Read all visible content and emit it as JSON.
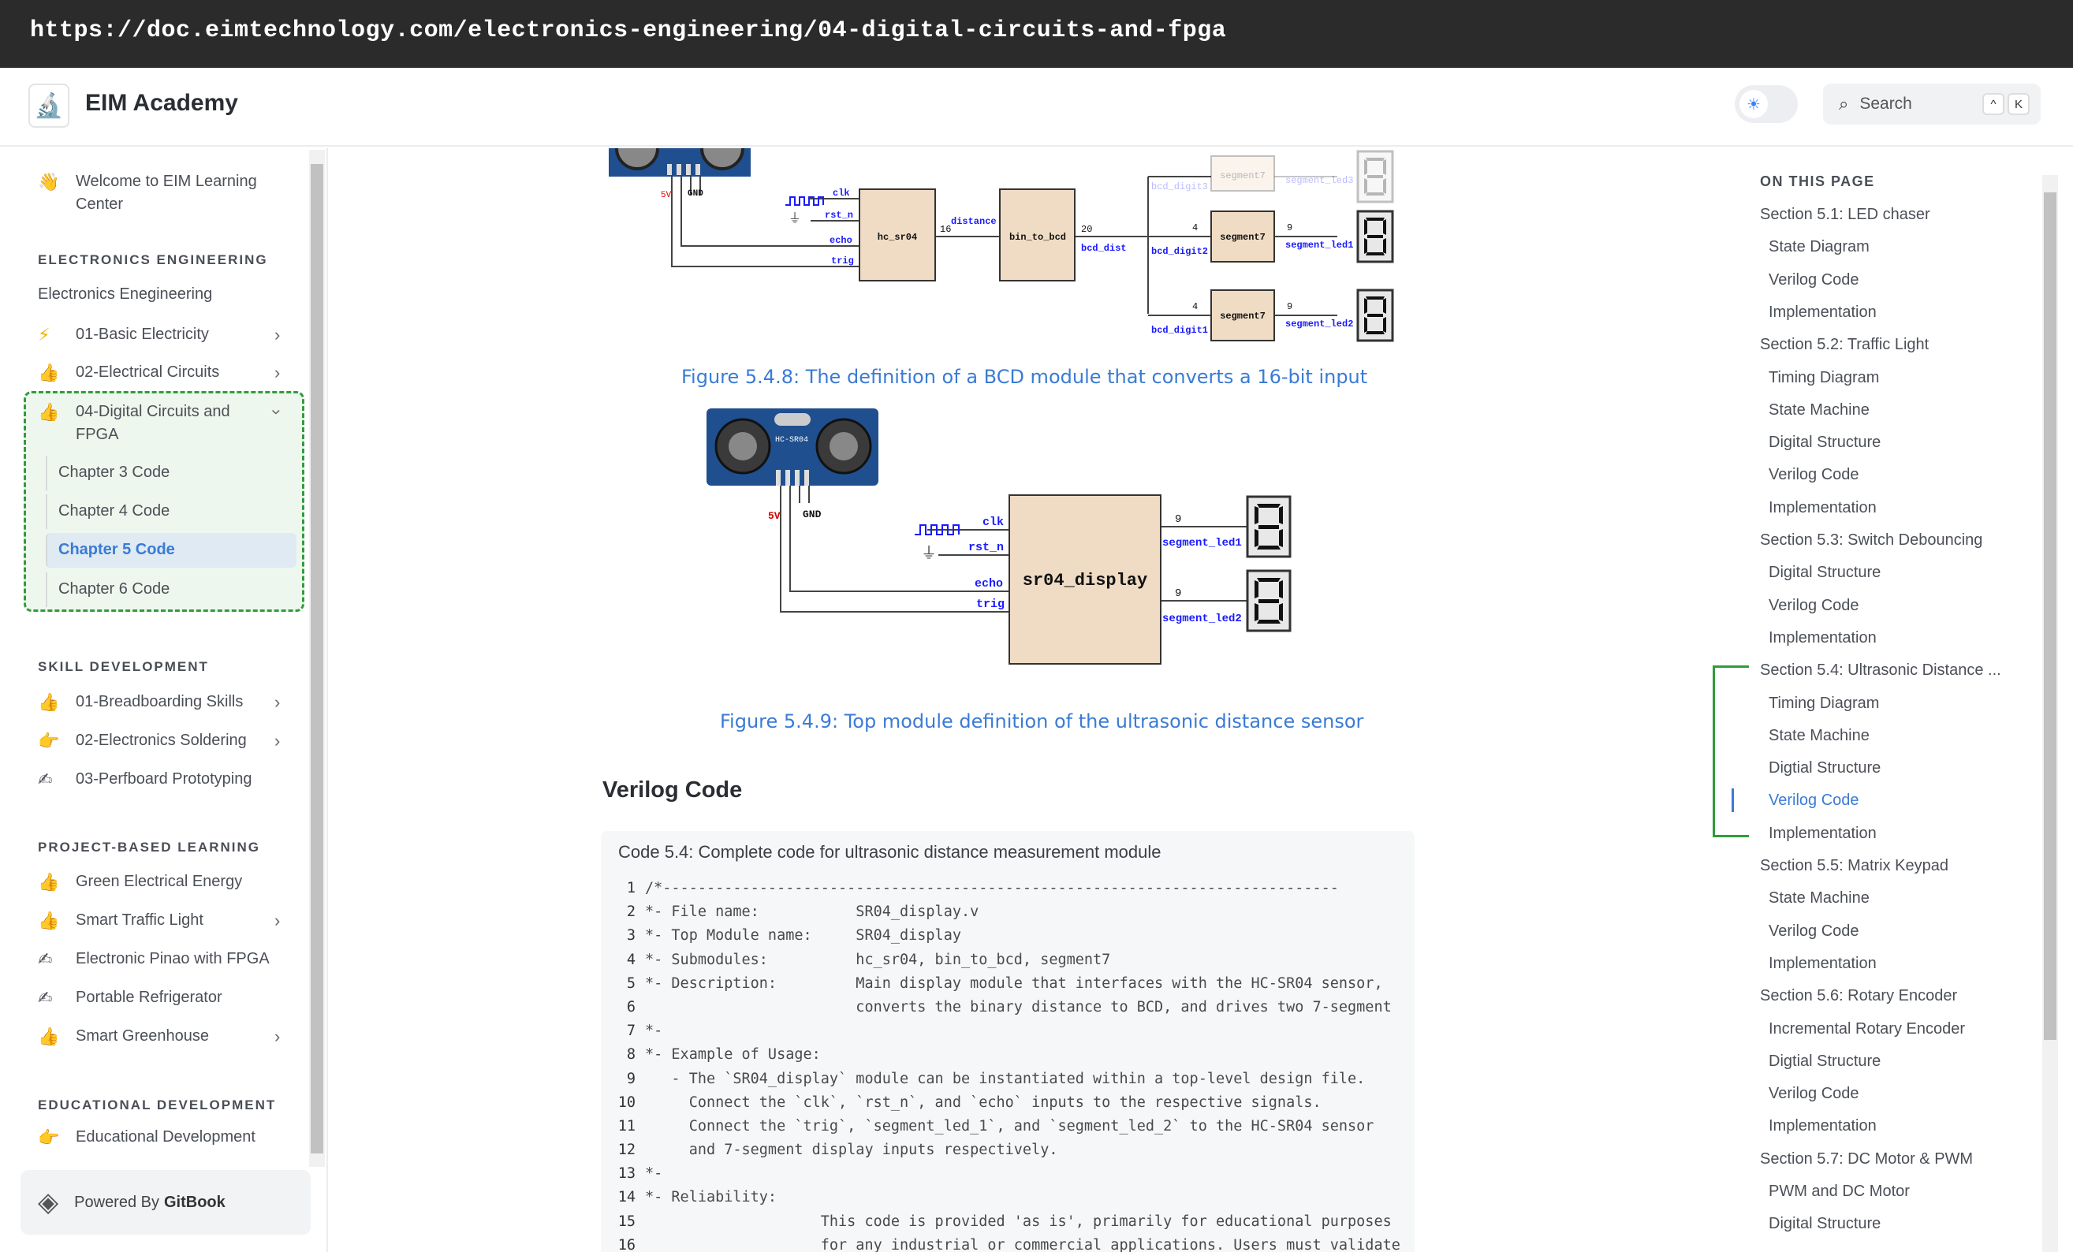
{
  "browser": {
    "url": "https://doc.eimtechnology.com/electronics-engineering/04-digital-circuits-and-fpga"
  },
  "header": {
    "brand": "EIM Academy",
    "search_placeholder": "Search",
    "kbd1": "^",
    "kbd2": "K"
  },
  "sidebar": {
    "welcome": "Welcome to EIM Learning Center",
    "sections": [
      {
        "title": "ELECTRONICS ENGINEERING"
      },
      {
        "title": "SKILL DEVELOPMENT"
      },
      {
        "title": "PROJECT-BASED LEARNING"
      },
      {
        "title": "EDUCATIONAL DEVELOPMENT"
      }
    ],
    "ee_plain": "Electronics Enegineering",
    "ee_items": [
      "01-Basic Electricity",
      "02-Electrical Circuits",
      "04-Digital Circuits and FPGA"
    ],
    "fpga_sub": [
      "Chapter 3 Code",
      "Chapter 4 Code",
      "Chapter 5 Code",
      "Chapter 6 Code"
    ],
    "skill_items": [
      "01-Breadboarding Skills",
      "02-Electronics Soldering",
      "03-Perfboard Prototyping"
    ],
    "pbl_items": [
      "Green Electrical Energy",
      "Smart Traffic Light",
      "Electronic Pinao with FPGA",
      "Portable Refrigerator",
      "Smart Greenhouse"
    ],
    "edu_items": [
      "Educational Development"
    ],
    "powered": "Powered By",
    "gitbook": "GitBook"
  },
  "figure1": {
    "caption": "Figure 5.4.8: The definition of a BCD module that converts a 16-bit input",
    "labels": {
      "v5": "5V",
      "gnd": "GND",
      "clk": "clk",
      "rst_n": "rst_n",
      "echo": "echo",
      "trig": "trig",
      "hc_sr04": "hc_sr04",
      "distance": "distance",
      "w16": "16",
      "bin_to_bcd": "bin_to_bcd",
      "w20": "20",
      "bcd_dist": "bcd_dist",
      "bcd_digit3": "bcd_digit3",
      "bcd_digit2": "bcd_digit2",
      "bcd_digit1": "bcd_digit1",
      "w4": "4",
      "w9": "9",
      "segment7": "segment7",
      "segment_led3": "segment_led3",
      "segment_led1": "segment_led1",
      "segment_led2": "segment_led2"
    }
  },
  "figure2": {
    "caption": "Figure 5.4.9: Top module definition of the ultrasonic distance sensor",
    "labels": {
      "hcsr04": "HC-SR04",
      "v5": "5V",
      "gnd": "GND",
      "clk": "clk",
      "rst_n": "rst_n",
      "echo": "echo",
      "trig": "trig",
      "module": "sr04_display",
      "w9": "9",
      "segment_led1": "segment_led1",
      "segment_led2": "segment_led2"
    }
  },
  "content": {
    "verilog_heading": "Verilog Code",
    "code_title": "Code 5.4: Complete code for ultrasonic distance measurement module",
    "code_lines": [
      {
        "n": "1",
        "t": "/*-----------------------------------------------------------------------------"
      },
      {
        "n": "2",
        "t": "*- File name:           SR04_display.v"
      },
      {
        "n": "3",
        "t": "*- Top Module name:     SR04_display"
      },
      {
        "n": "4",
        "t": "*- Submodules:          hc_sr04, bin_to_bcd, segment7"
      },
      {
        "n": "5",
        "t": "*- Description:         Main display module that interfaces with the HC-SR04 sensor,"
      },
      {
        "n": "6",
        "t": "                        converts the binary distance to BCD, and drives two 7-segment"
      },
      {
        "n": "7",
        "t": "*-"
      },
      {
        "n": "8",
        "t": "*- Example of Usage:"
      },
      {
        "n": "9",
        "t": "   - The `SR04_display` module can be instantiated within a top-level design file."
      },
      {
        "n": "10",
        "t": "     Connect the `clk`, `rst_n`, and `echo` inputs to the respective signals."
      },
      {
        "n": "11",
        "t": "     Connect the `trig`, `segment_led_1`, and `segment_led_2` to the HC-SR04 sensor"
      },
      {
        "n": "12",
        "t": "     and 7-segment display inputs respectively."
      },
      {
        "n": "13",
        "t": "*-"
      },
      {
        "n": "14",
        "t": "*- Reliability:"
      },
      {
        "n": "15",
        "t": "                    This code is provided 'as is', primarily for educational purposes"
      },
      {
        "n": "16",
        "t": "                    for any industrial or commercial applications. Users must validate"
      }
    ]
  },
  "toc": {
    "heading": "ON THIS PAGE",
    "items": [
      "Section 5.1: LED chaser",
      "State Diagram",
      "Verilog Code",
      "Implementation",
      "Section 5.2: Traffic Light",
      "Timing Diagram",
      "State Machine",
      "Digital Structure",
      "Verilog Code",
      "Implementation",
      "Section 5.3: Switch Debouncing",
      "Digital Structure",
      "Verilog Code",
      "Implementation",
      "Section 5.4: Ultrasonic Distance ...",
      "Timing Diagram",
      "State Machine",
      "Digtial Structure",
      "Verilog Code",
      "Implementation",
      "Section 5.5: Matrix Keypad",
      "State Machine",
      "Verilog Code",
      "Implementation",
      "Section 5.6: Rotary Encoder",
      "Incremental Rotary Encoder",
      "Digtial Structure",
      "Verilog Code",
      "Implementation",
      "Section 5.7: DC Motor & PWM",
      "PWM and DC Motor",
      "Digital Structure"
    ]
  },
  "colors": {
    "accent": "#3a7bd5",
    "highlight_green": "#2f9d3a",
    "module_fill": "#f0dcc4",
    "sensor_blue": "#1f4f8f",
    "wire_label": "#1a1aff",
    "supply_red": "#d40000"
  }
}
